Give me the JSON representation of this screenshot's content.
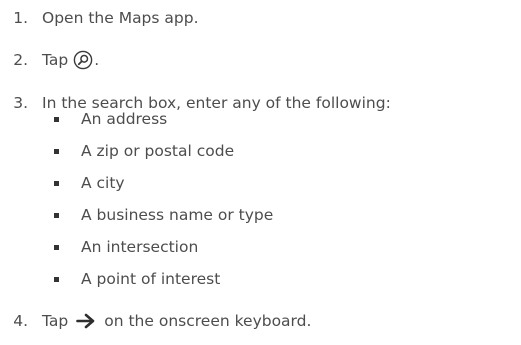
{
  "steps": [
    {
      "number": "1.",
      "text": "Open the Maps app."
    },
    {
      "number": "2.",
      "text_before": "Tap",
      "icon": "search-icon",
      "text_after": "."
    },
    {
      "number": "3.",
      "text": "In the search box, enter any of the following:"
    },
    {
      "number": "4.",
      "text_before": "Tap",
      "icon": "arrow-right-icon",
      "text_after": "on the onscreen keyboard."
    }
  ],
  "bullets": [
    "An address",
    "A zip or postal code",
    "A city",
    "A business name or type",
    "An intersection",
    "A point of interest"
  ]
}
